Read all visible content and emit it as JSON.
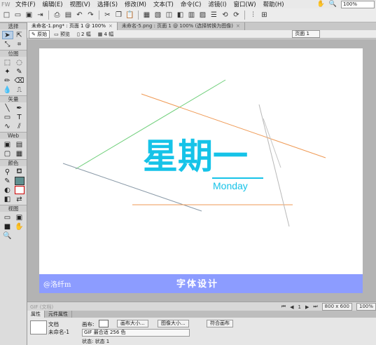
{
  "menubar": {
    "app_icon": "FW",
    "items": [
      "文件(F)",
      "编辑(E)",
      "视图(V)",
      "选择(S)",
      "修改(M)",
      "文本(T)",
      "命令(C)",
      "滤镜(I)",
      "窗口(W)",
      "帮助(H)"
    ],
    "zoom_value": "100%"
  },
  "tools": {
    "sections": {
      "select": "选择",
      "bitmap": "位图",
      "vector": "矢量",
      "web": "Web",
      "colors": "颜色",
      "view": "视图"
    },
    "text_tool": "T"
  },
  "doc_tabs": [
    {
      "label": "未命名-1.png* : 页面 1 @ 100%",
      "active": true
    },
    {
      "label": "未命名-5.png : 页面 1 @ 100% (选择转换为图像)",
      "active": false
    }
  ],
  "view_bar": {
    "buttons": [
      "原始",
      "预览",
      "2 幅",
      "4 幅"
    ],
    "active": "原始",
    "page_selector": "页面 1"
  },
  "canvas": {
    "heading": "星期一",
    "subheading": "Monday",
    "credit": "@洛纤m",
    "footer_title": "字体设计",
    "colors": {
      "heading": "#16c3e8",
      "footer_bg": "#8c9cff",
      "line_green": "#6fcf7a",
      "line_orange": "#ef9a55",
      "line_gray": "#b8b8b8",
      "line_slate": "#8a9aa8"
    }
  },
  "statusbar": {
    "format": "GIF (文档)",
    "page": "1",
    "size": "800 x 600",
    "zoom": "100%"
  },
  "props_tabs": [
    "属性",
    "元件属性"
  ],
  "properties": {
    "doc_label": "文档",
    "doc_name": "未命名-1",
    "canvas_label": "画布:",
    "canvas_size_btn": "画布大小...",
    "image_size_btn": "图像大小...",
    "fit_canvas_btn": "符合画布",
    "format": "GIF 最合适 256 色",
    "state_label": "状态: 状态 1"
  }
}
